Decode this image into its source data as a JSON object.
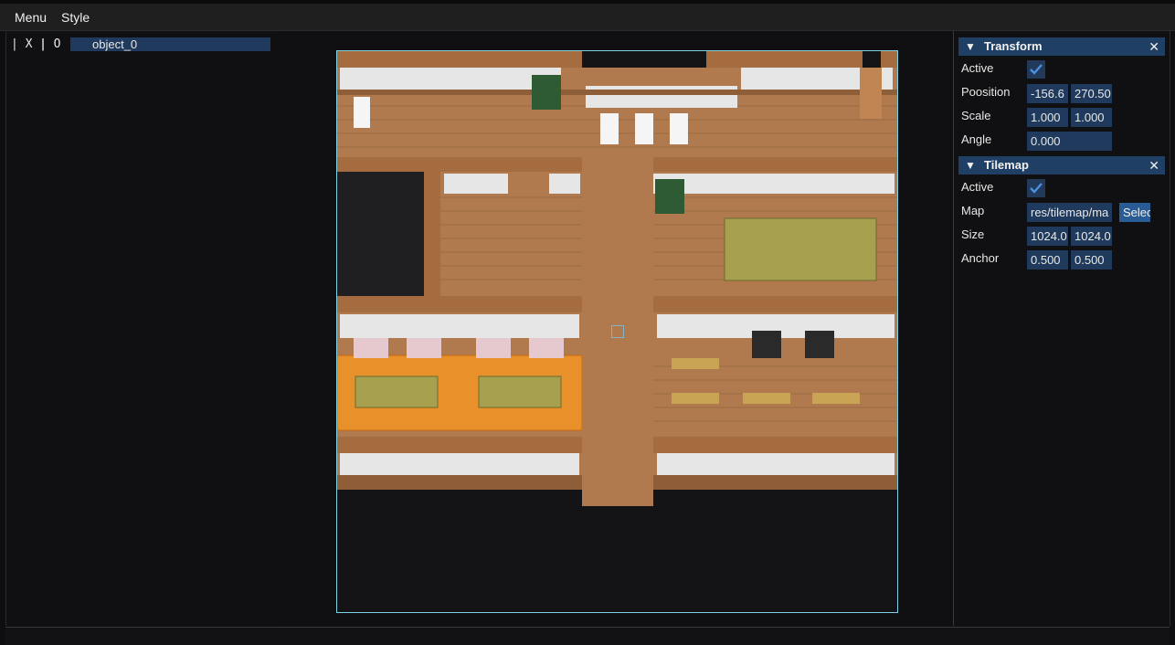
{
  "menubar": {
    "menu": "Menu",
    "style": "Style"
  },
  "hierarchy": {
    "toggle_x": "| X |",
    "toggle_o": "| O |",
    "object": "object_0"
  },
  "transform": {
    "title": "Transform",
    "active_label": "Active",
    "active": true,
    "position_label": "Poosition",
    "position_x": "-156.6",
    "position_y": "270.50",
    "scale_label": "Scale",
    "scale_x": "1.000",
    "scale_y": "1.000",
    "angle_label": "Angle",
    "angle": "0.000"
  },
  "tilemap": {
    "title": "Tilemap",
    "active_label": "Active",
    "active": true,
    "map_label": "Map",
    "map_path": "res/tilemap/ma",
    "select_button": "Selec",
    "size_label": "Size",
    "size_w": "1024.0",
    "size_h": "1024.0",
    "anchor_label": "Anchor",
    "anchor_x": "0.500",
    "anchor_y": "0.500"
  },
  "icons": {
    "collapse": "triangle-down-icon",
    "close": "close-icon",
    "check": "checkmark-icon"
  },
  "colors": {
    "accent": "#295c94",
    "field": "#1f3a5c",
    "header": "#1f3f64",
    "viewport_border": "#7fd3e6",
    "floor": "#b07a4e",
    "wall": "#e6e6e6",
    "rug": "#e8902a"
  }
}
